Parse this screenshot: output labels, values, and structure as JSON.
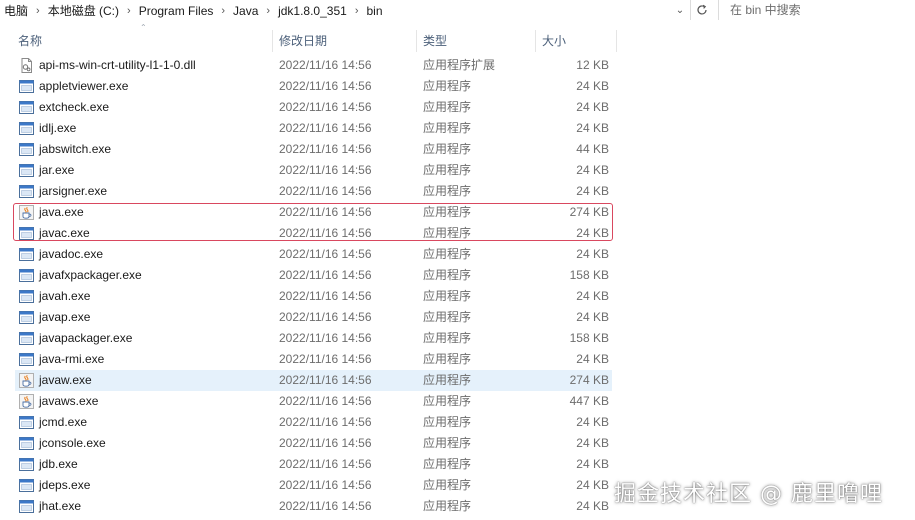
{
  "address_bar": {
    "crumbs": [
      "电脑",
      "本地磁盘 (C:)",
      "Program Files",
      "Java",
      "jdk1.8.0_351",
      "bin"
    ],
    "search_placeholder": "在 bin 中搜索"
  },
  "columns": {
    "name": "名称",
    "date": "修改日期",
    "type": "类型",
    "size": "大小"
  },
  "files": [
    {
      "name": "api-ms-win-crt-utility-l1-1-0.dll",
      "date": "2022/11/16 14:56",
      "type": "应用程序扩展",
      "size": "12 KB",
      "icon": "dll-file-icon"
    },
    {
      "name": "appletviewer.exe",
      "date": "2022/11/16 14:56",
      "type": "应用程序",
      "size": "24 KB",
      "icon": "exe-window-icon"
    },
    {
      "name": "extcheck.exe",
      "date": "2022/11/16 14:56",
      "type": "应用程序",
      "size": "24 KB",
      "icon": "exe-window-icon"
    },
    {
      "name": "idlj.exe",
      "date": "2022/11/16 14:56",
      "type": "应用程序",
      "size": "24 KB",
      "icon": "exe-window-icon"
    },
    {
      "name": "jabswitch.exe",
      "date": "2022/11/16 14:56",
      "type": "应用程序",
      "size": "44 KB",
      "icon": "exe-window-icon"
    },
    {
      "name": "jar.exe",
      "date": "2022/11/16 14:56",
      "type": "应用程序",
      "size": "24 KB",
      "icon": "exe-window-icon"
    },
    {
      "name": "jarsigner.exe",
      "date": "2022/11/16 14:56",
      "type": "应用程序",
      "size": "24 KB",
      "icon": "exe-window-icon"
    },
    {
      "name": "java.exe",
      "date": "2022/11/16 14:56",
      "type": "应用程序",
      "size": "274 KB",
      "icon": "java-cup-icon"
    },
    {
      "name": "javac.exe",
      "date": "2022/11/16 14:56",
      "type": "应用程序",
      "size": "24 KB",
      "icon": "exe-window-icon"
    },
    {
      "name": "javadoc.exe",
      "date": "2022/11/16 14:56",
      "type": "应用程序",
      "size": "24 KB",
      "icon": "exe-window-icon"
    },
    {
      "name": "javafxpackager.exe",
      "date": "2022/11/16 14:56",
      "type": "应用程序",
      "size": "158 KB",
      "icon": "exe-window-icon"
    },
    {
      "name": "javah.exe",
      "date": "2022/11/16 14:56",
      "type": "应用程序",
      "size": "24 KB",
      "icon": "exe-window-icon"
    },
    {
      "name": "javap.exe",
      "date": "2022/11/16 14:56",
      "type": "应用程序",
      "size": "24 KB",
      "icon": "exe-window-icon"
    },
    {
      "name": "javapackager.exe",
      "date": "2022/11/16 14:56",
      "type": "应用程序",
      "size": "158 KB",
      "icon": "exe-window-icon"
    },
    {
      "name": "java-rmi.exe",
      "date": "2022/11/16 14:56",
      "type": "应用程序",
      "size": "24 KB",
      "icon": "exe-window-icon"
    },
    {
      "name": "javaw.exe",
      "date": "2022/11/16 14:56",
      "type": "应用程序",
      "size": "274 KB",
      "icon": "java-cup-icon"
    },
    {
      "name": "javaws.exe",
      "date": "2022/11/16 14:56",
      "type": "应用程序",
      "size": "447 KB",
      "icon": "java-cup-icon"
    },
    {
      "name": "jcmd.exe",
      "date": "2022/11/16 14:56",
      "type": "应用程序",
      "size": "24 KB",
      "icon": "exe-window-icon"
    },
    {
      "name": "jconsole.exe",
      "date": "2022/11/16 14:56",
      "type": "应用程序",
      "size": "24 KB",
      "icon": "exe-window-icon"
    },
    {
      "name": "jdb.exe",
      "date": "2022/11/16 14:56",
      "type": "应用程序",
      "size": "24 KB",
      "icon": "exe-window-icon"
    },
    {
      "name": "jdeps.exe",
      "date": "2022/11/16 14:56",
      "type": "应用程序",
      "size": "24 KB",
      "icon": "exe-window-icon"
    },
    {
      "name": "jhat.exe",
      "date": "2022/11/16 14:56",
      "type": "应用程序",
      "size": "24 KB",
      "icon": "exe-window-icon"
    }
  ],
  "selected_file": "javaw.exe",
  "highlighted_files": [
    "java.exe",
    "javac.exe"
  ],
  "colors": {
    "selection": "#e5f1fb",
    "highlight_border": "#d9485f",
    "header_text": "#4c607a",
    "meta_text": "#6d6d6d"
  },
  "watermark": "掘金技术社区 @ 鹿里噜哩"
}
